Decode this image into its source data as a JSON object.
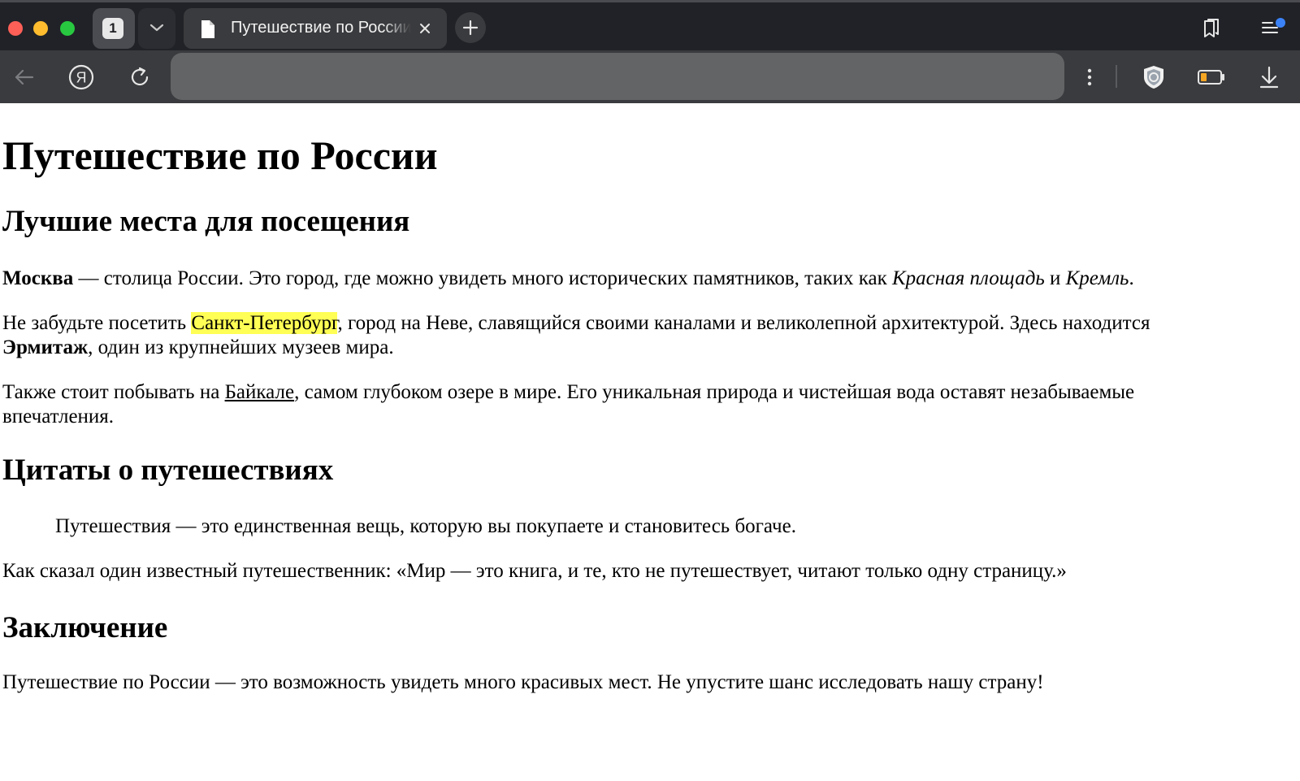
{
  "browser": {
    "tab_count": "1",
    "tab_title": "Путешествие по России",
    "address_value": ""
  },
  "page": {
    "title": "Путешествие по России",
    "section1": {
      "heading": "Лучшие места для посещения",
      "p1": {
        "bold": "Москва",
        "text1": " — столица России. Это город, где можно увидеть много исторических памятников, таких как ",
        "italic1": "Красная площадь",
        "text2": " и ",
        "italic2": "Кремль",
        "text3": "."
      },
      "p2": {
        "text1": "Не забудьте посетить ",
        "highlight": "Санкт-Петербург",
        "text2": ", город на Неве, славящийся своими каналами и великолепной архитектурой. Здесь находится ",
        "bold": "Эрмитаж",
        "text3": ", один из крупнейших музеев мира."
      },
      "p3": {
        "text1": "Также стоит побывать на ",
        "link": "Байкале",
        "text2": ", самом глубоком озере в мире. Его уникальная природа и чистейшая вода оставят незабываемые впечатления."
      }
    },
    "section2": {
      "heading": "Цитаты о путешествиях",
      "quote": "Путешествия — это единственная вещь, которую вы покупаете и становитесь богаче.",
      "p": "Как сказал один известный путешественник: «Мир — это книга, и те, кто не путешествует, читают только одну страницу.»"
    },
    "section3": {
      "heading": "Заключение",
      "p": "Путешествие по России — это возможность увидеть много красивых мест. Не упустите шанс исследовать нашу страну!"
    }
  },
  "colors": {
    "highlight": "#ffff55",
    "notification_dot": "#3b82f6"
  },
  "icons": [
    "document-icon",
    "close-icon",
    "plus-icon",
    "bookmarks-icon",
    "sidebar-icon",
    "back-arrow-icon",
    "yandex-logo-icon",
    "reload-icon",
    "kebab-menu-icon",
    "shield-icon",
    "battery-icon",
    "download-icon",
    "chevron-down-icon"
  ]
}
